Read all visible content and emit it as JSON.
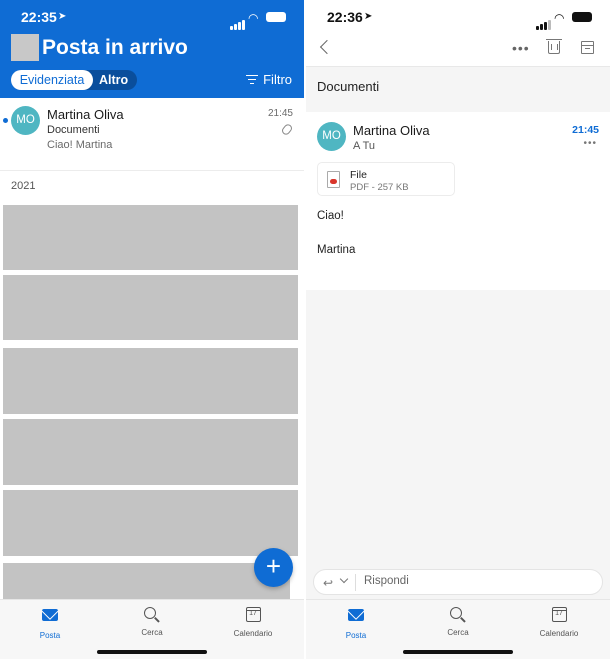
{
  "left": {
    "status": {
      "time": "22:35"
    },
    "title": "Posta in arrivo",
    "tabs": {
      "focused": "Evidenziata",
      "other": "Altro"
    },
    "filter_label": "Filtro",
    "message": {
      "initials": "MO",
      "sender": "Martina Oliva",
      "time": "21:45",
      "subject": "Documenti",
      "preview": "Ciao! Martina"
    },
    "year_header": "2021",
    "fab_symbol": "+",
    "tabbar": {
      "mail": "Posta",
      "search": "Cerca",
      "calendar": "Calendario",
      "calendar_day": "17"
    }
  },
  "right": {
    "status": {
      "time": "22:36"
    },
    "toolbar": {
      "more_symbol": "•••"
    },
    "subject": "Documenti",
    "message": {
      "initials": "MO",
      "sender": "Martina Oliva",
      "recipient": "A Tu",
      "time": "21:45",
      "more_symbol": "•••",
      "attachment": {
        "name": "File",
        "meta": "PDF - 257 KB"
      },
      "body_lines": [
        "Ciao!",
        "Martina"
      ]
    },
    "reply": {
      "arrow_symbol": "↩",
      "placeholder": "Rispondi"
    },
    "tabbar": {
      "mail": "Posta",
      "search": "Cerca",
      "calendar": "Calendario",
      "calendar_day": "17"
    }
  },
  "colors": {
    "brand_blue": "#0f6cd4",
    "avatar_teal": "#4fb6c2",
    "redacted_gray": "#c3c3c3"
  }
}
